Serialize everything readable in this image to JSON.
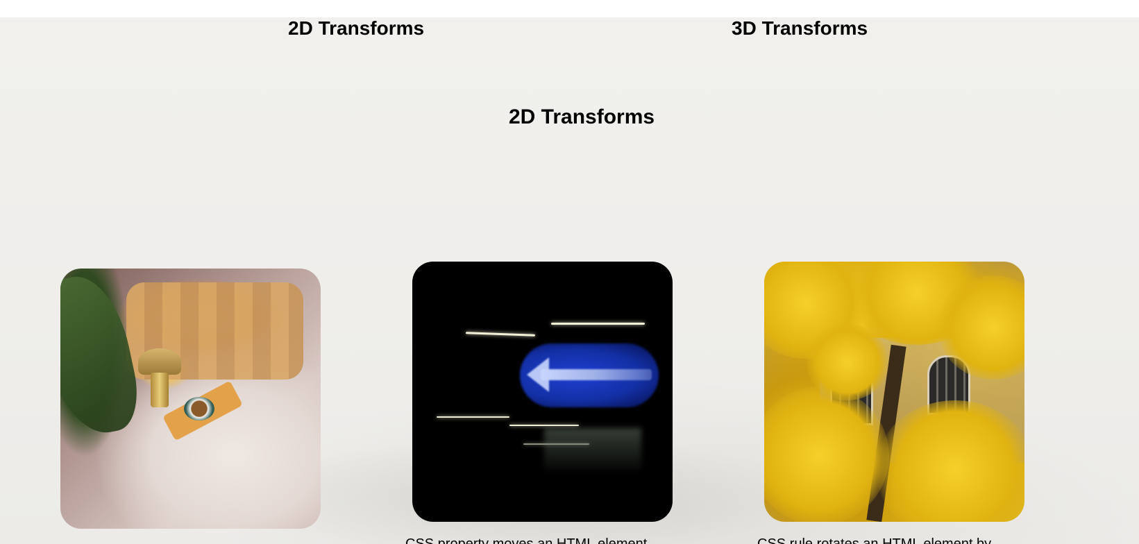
{
  "nav": {
    "link_2d": "2D Transforms",
    "link_3d": "3D Transforms"
  },
  "section": {
    "title": "2D Transforms"
  },
  "cards": [
    {
      "image": "cozy-sofa-photo",
      "caption": ""
    },
    {
      "image": "blurred-blue-arrow-sign-photo",
      "caption": "CSS property moves an HTML element"
    },
    {
      "image": "yellow-ginkgo-tree-building-photo",
      "caption": "CSS rule rotates an HTML element by"
    }
  ],
  "colors": {
    "text": "#000000",
    "background": "#efeeeb"
  }
}
